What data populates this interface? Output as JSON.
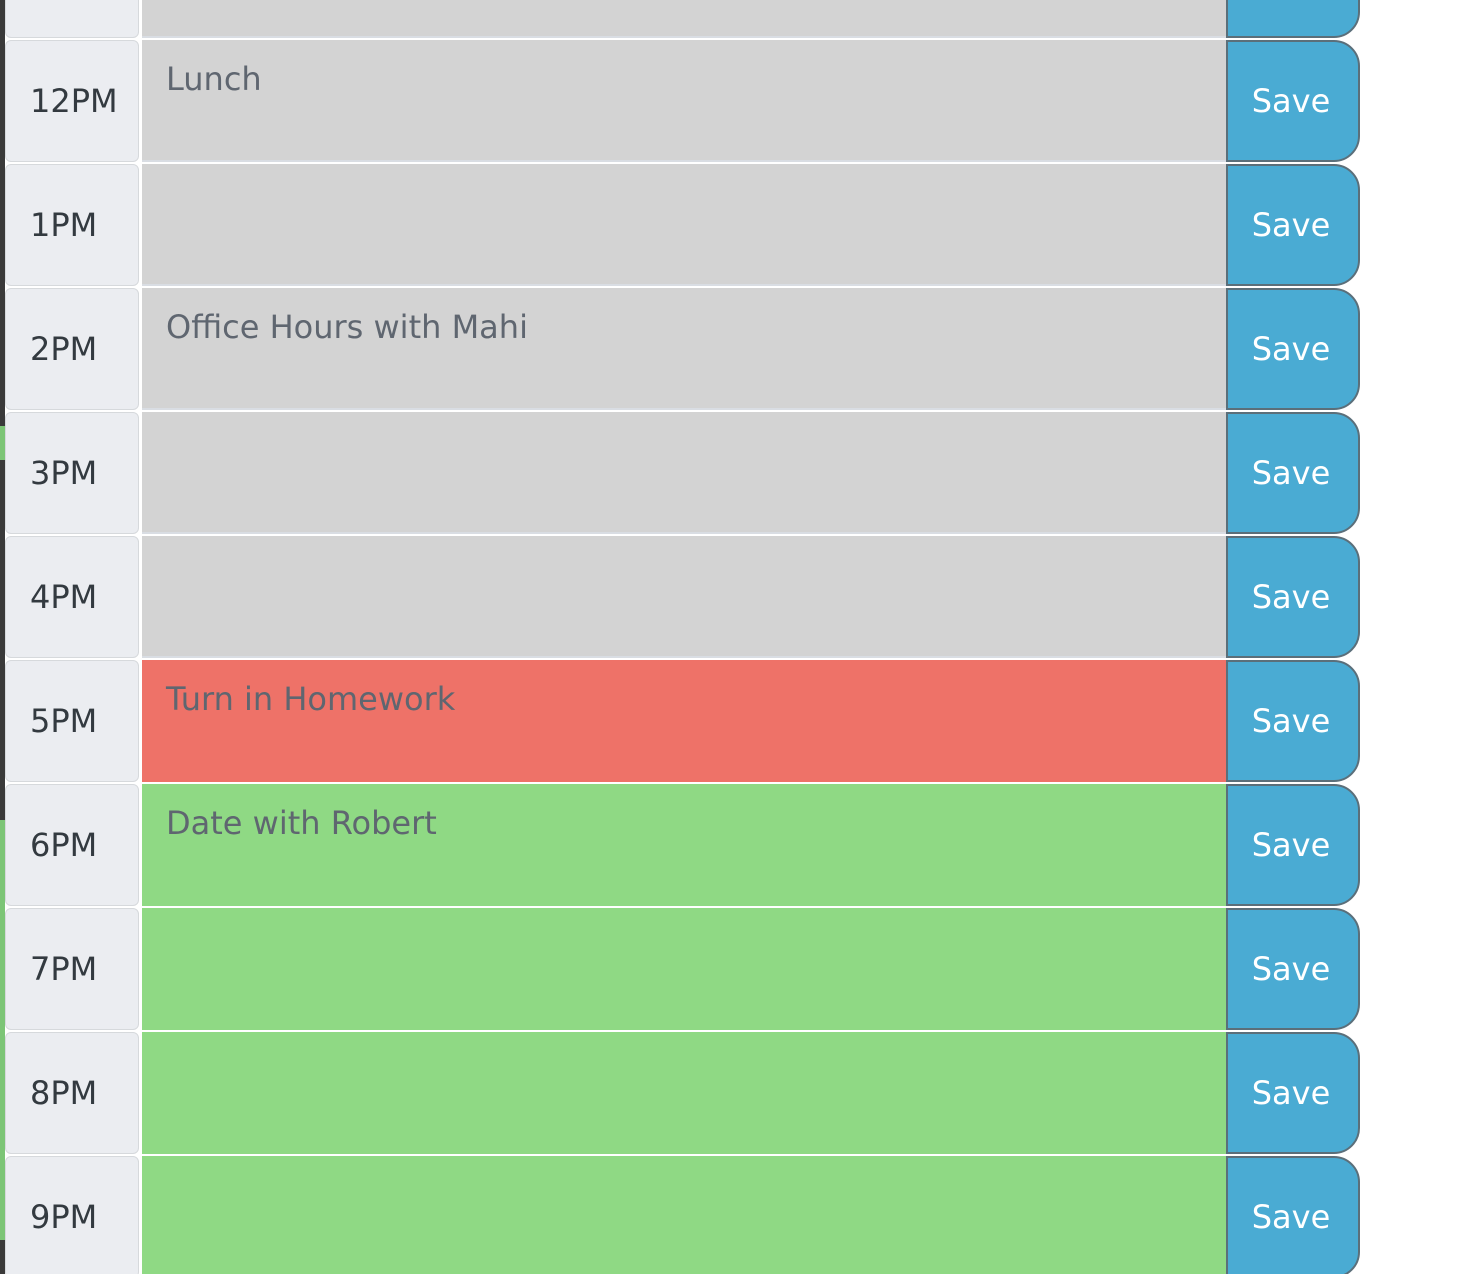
{
  "colors": {
    "past": "#d3d3d3",
    "present": "#ee7268",
    "future": "#8fd984",
    "save": "#4aabd3"
  },
  "rows": [
    {
      "hour": "",
      "text": "",
      "state": "past"
    },
    {
      "hour": "12PM",
      "text": "Lunch",
      "state": "past"
    },
    {
      "hour": "1PM",
      "text": "",
      "state": "past"
    },
    {
      "hour": "2PM",
      "text": "Office Hours with Mahi",
      "state": "past"
    },
    {
      "hour": "3PM",
      "text": "",
      "state": "past"
    },
    {
      "hour": "4PM",
      "text": "",
      "state": "past"
    },
    {
      "hour": "5PM",
      "text": "Turn in Homework",
      "state": "present"
    },
    {
      "hour": "6PM",
      "text": "Date with Robert",
      "state": "future"
    },
    {
      "hour": "7PM",
      "text": "",
      "state": "future"
    },
    {
      "hour": "8PM",
      "text": "",
      "state": "future"
    },
    {
      "hour": "9PM",
      "text": "",
      "state": "future"
    }
  ],
  "save_label": "Save"
}
